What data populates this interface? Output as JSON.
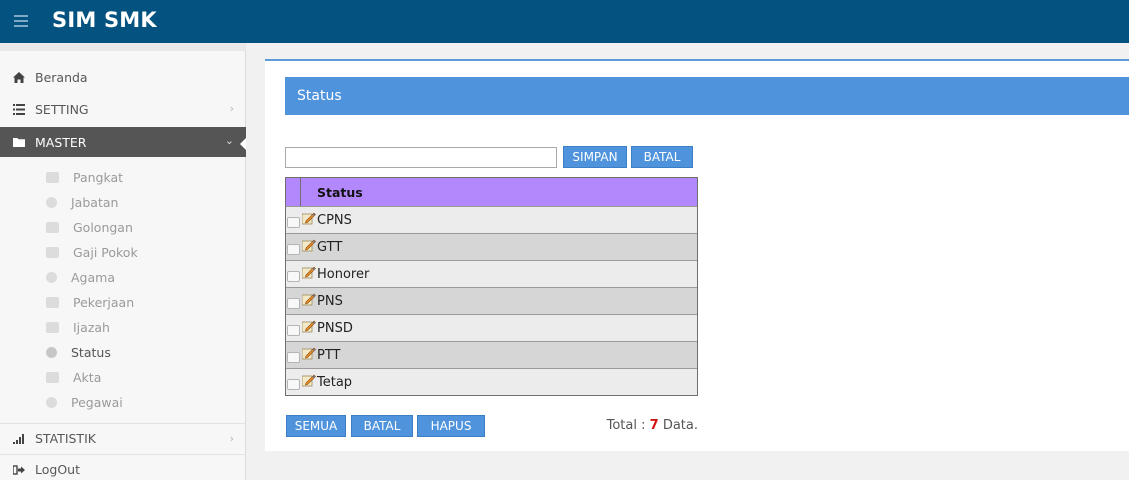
{
  "app": {
    "title": "SIM SMK"
  },
  "sidebar": {
    "items": [
      {
        "label": "Beranda",
        "icon": "home-icon"
      },
      {
        "label": "SETTING",
        "icon": "list-icon"
      },
      {
        "label": "MASTER",
        "icon": "folder-icon"
      },
      {
        "label": "STATISTIK",
        "icon": "bar-chart-icon"
      },
      {
        "label": "LogOut",
        "icon": "logout-icon"
      }
    ],
    "master_items": [
      {
        "label": "Pangkat",
        "icon": "document-icon"
      },
      {
        "label": "Jabatan",
        "icon": "tag-icon"
      },
      {
        "label": "Golongan",
        "icon": "table-icon"
      },
      {
        "label": "Gaji Pokok",
        "icon": "money-icon"
      },
      {
        "label": "Agama",
        "icon": "lightbulb-icon"
      },
      {
        "label": "Pekerjaan",
        "icon": "briefcase-icon"
      },
      {
        "label": "Ijazah",
        "icon": "certificate-icon"
      },
      {
        "label": "Status",
        "icon": "gears-icon"
      },
      {
        "label": "Akta",
        "icon": "pencil-icon"
      },
      {
        "label": "Pegawai",
        "icon": "users-icon"
      }
    ]
  },
  "panel": {
    "title": "Status",
    "input_value": "",
    "simpan_label": "SIMPAN",
    "batal_label": "BATAL"
  },
  "table": {
    "header": "Status",
    "rows": [
      "CPNS",
      "GTT",
      "Honorer",
      "PNS",
      "PNSD",
      "PTT",
      "Tetap"
    ]
  },
  "footer": {
    "semua_label": "SEMUA",
    "batal_label": "BATAL",
    "hapus_label": "HAPUS",
    "total_prefix": "Total :",
    "total_count": "7",
    "total_suffix": "Data."
  },
  "colors": {
    "topbar": "#04527f",
    "accent": "#4f93dc",
    "table_header": "#b388fd",
    "active_nav": "#555555",
    "total_count": "#d41515"
  }
}
